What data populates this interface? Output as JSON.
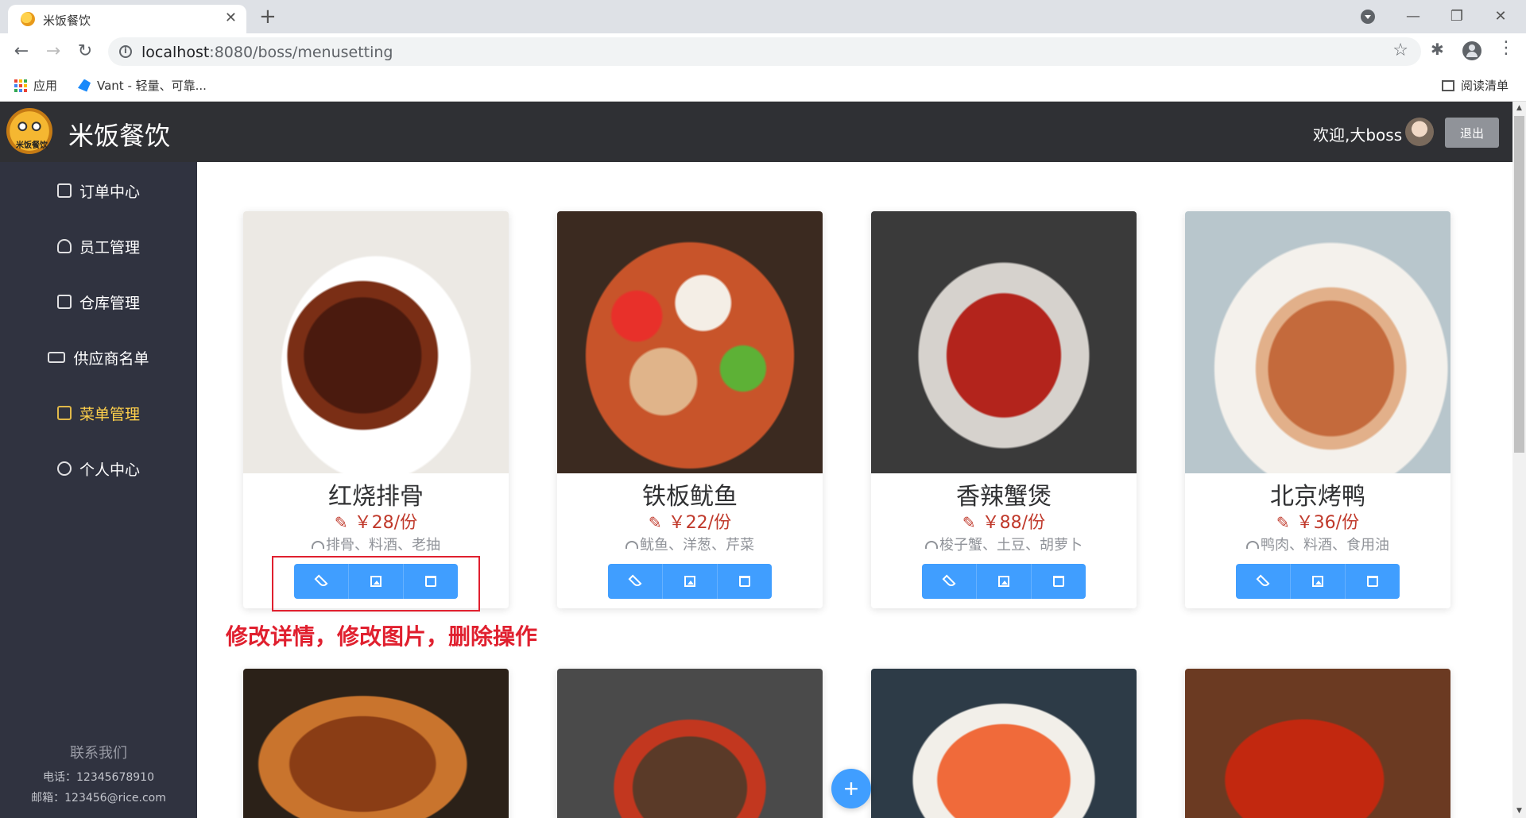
{
  "browser": {
    "tab_title": "米饭餐饮",
    "url_host": "localhost",
    "url_rest": ":8080/boss/menusetting",
    "bookmarks": [
      {
        "label": "应用",
        "icon": "apps-icon"
      },
      {
        "label": "Vant - 轻量、可靠...",
        "icon": "vant-icon"
      }
    ],
    "reading_list": "阅读清单"
  },
  "app": {
    "logo_text": "米饭餐饮",
    "title": "米饭餐饮",
    "welcome": "欢迎,大boss",
    "logout": "退出"
  },
  "sidebar": {
    "items": [
      {
        "label": "订单中心",
        "icon": "document-icon",
        "active": false
      },
      {
        "label": "员工管理",
        "icon": "user-icon",
        "active": false
      },
      {
        "label": "仓库管理",
        "icon": "warehouse-icon",
        "active": false
      },
      {
        "label": "供应商名单",
        "icon": "truck-icon",
        "active": false
      },
      {
        "label": "菜单管理",
        "icon": "edit-icon",
        "active": true
      },
      {
        "label": "个人中心",
        "icon": "gear-icon",
        "active": false
      }
    ],
    "contact_title": "联系我们",
    "phone": "电话：12345678910",
    "email": "邮箱：123456@rice.com"
  },
  "dishes": [
    {
      "name": "红烧排骨",
      "price": "￥28/份",
      "ingredients": "排骨、料酒、老抽"
    },
    {
      "name": "铁板鱿鱼",
      "price": "￥22/份",
      "ingredients": "鱿鱼、洋葱、芹菜"
    },
    {
      "name": "香辣蟹煲",
      "price": "￥88/份",
      "ingredients": "梭子蟹、土豆、胡萝卜"
    },
    {
      "name": "北京烤鸭",
      "price": "￥36/份",
      "ingredients": "鸭肉、料酒、食用油"
    }
  ],
  "annotation": "修改详情，修改图片，删除操作",
  "colors": {
    "primary": "#409eff",
    "sidebar_bg": "#303340",
    "header_bg": "#2f3034",
    "active_menu": "#ffd04b",
    "price": "#c0392b",
    "annotation": "#e0202f"
  }
}
